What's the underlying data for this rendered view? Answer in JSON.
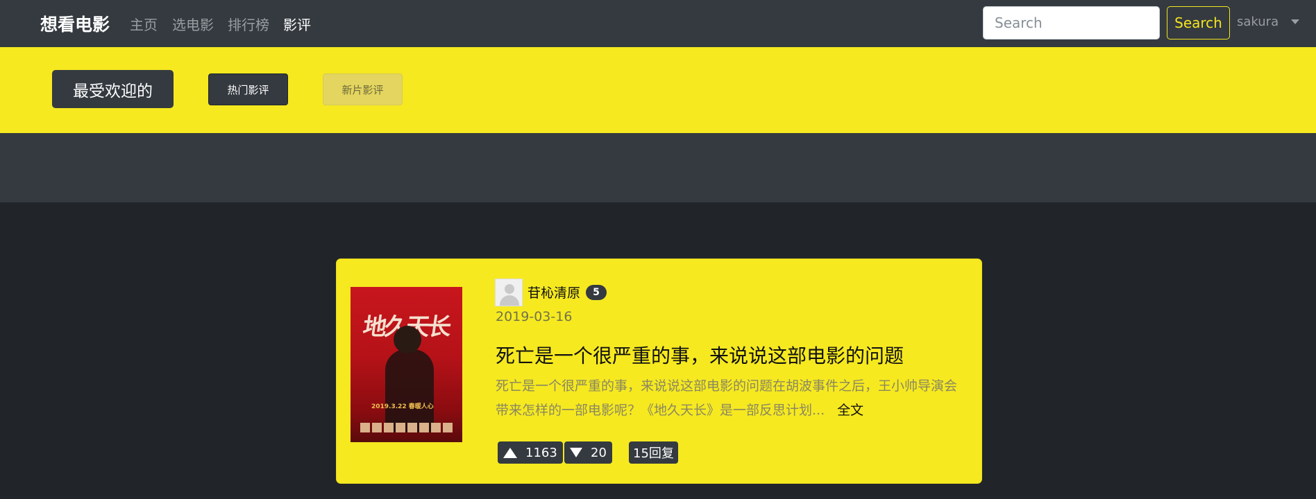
{
  "nav": {
    "brand": "想看电影",
    "links": [
      "主页",
      "选电影",
      "排行榜",
      "影评"
    ],
    "search_placeholder": "Search",
    "search_button": "Search",
    "user": "sakura"
  },
  "banner": {
    "heading": "最受欢迎的",
    "tab_hot": "热门影评",
    "tab_new": "新片影评"
  },
  "review": {
    "poster_title": "地久天长",
    "poster_date": "2019.3.22 春暖人心",
    "author": "苷杺清原",
    "author_level": "5",
    "date": "2019-03-16",
    "title": "死亡是一个很严重的事，来说说这部电影的问题",
    "excerpt": "死亡是一个很严重的事，来说说这部电影的问题在胡波事件之后，王小帅导演会带来怎样的一部电影呢？《地久天长》是一部反思计划...",
    "full_text_link": "全文",
    "upvotes": "1163",
    "downvotes": "20",
    "replies": "15回复"
  }
}
